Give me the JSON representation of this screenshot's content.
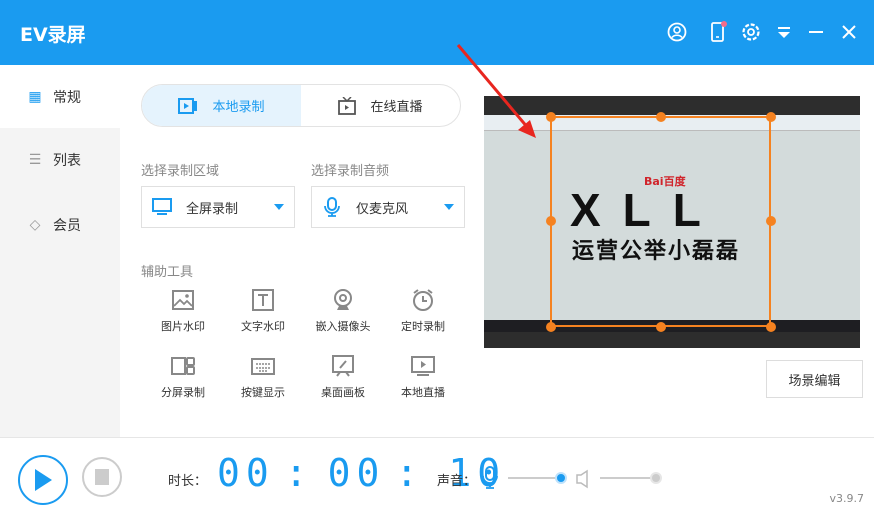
{
  "app": {
    "title": "EV录屏",
    "version": "v3.9.7"
  },
  "header_icons": [
    "user-icon",
    "phone-icon",
    "gear-icon",
    "dropdown-icon",
    "minimize-icon",
    "close-icon"
  ],
  "sidebar": {
    "items": [
      {
        "label": "常规",
        "icon": "grid-icon",
        "active": true
      },
      {
        "label": "列表",
        "icon": "list-icon"
      },
      {
        "label": "会员",
        "icon": "diamond-icon"
      }
    ]
  },
  "tabs": [
    {
      "label": "本地录制",
      "active": true
    },
    {
      "label": "在线直播"
    }
  ],
  "area": {
    "label": "选择录制区域",
    "value": "全屏录制"
  },
  "audio": {
    "label": "选择录制音频",
    "value": "仅麦克风"
  },
  "tools": {
    "label": "辅助工具",
    "items": [
      "图片水印",
      "文字水印",
      "嵌入摄像头",
      "定时录制",
      "分屏录制",
      "按键显示",
      "桌面画板",
      "本地直播"
    ]
  },
  "preview": {
    "logo_text": "XLL",
    "subtitle": "运营公举小磊磊",
    "baidu": "Bai百度"
  },
  "scene_edit": "场景编辑",
  "bottom": {
    "duration_label": "时长：",
    "h": "00",
    "m": "00",
    "s": "10",
    "sound_label": "声音：",
    "mic_volume": 0.95,
    "speaker_volume": 1.0
  },
  "colors": {
    "accent": "#1a9bf0",
    "selection": "#f58220"
  }
}
